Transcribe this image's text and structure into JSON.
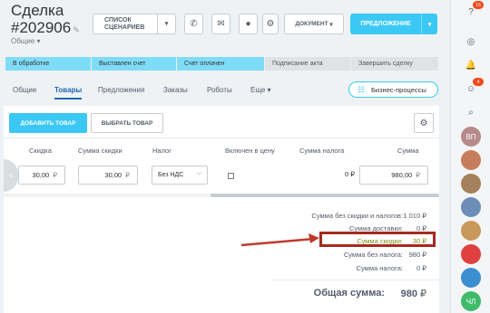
{
  "header": {
    "deal_label": "Сделка",
    "deal_number": "#202906",
    "subtitle": "Общие",
    "scenarios_button": "СПИСОК СЦЕНАРИЕВ",
    "document_button": "ДОКУМЕНТ",
    "offer_button": "ПРЕДЛОЖЕНИЕ"
  },
  "stages": [
    {
      "label": "В обработке",
      "state": "done"
    },
    {
      "label": "Выставлен счет",
      "state": "done"
    },
    {
      "label": "Счет оплачен",
      "state": "done"
    },
    {
      "label": "Подписание акта",
      "state": "todo"
    },
    {
      "label": "Завершить сделку",
      "state": "todo"
    }
  ],
  "tabs": [
    "Общие",
    "Товары",
    "Предложения",
    "Заказы",
    "Роботы",
    "Еще"
  ],
  "active_tab": "Товары",
  "business_processes_button": "Бизнес-процессы",
  "products": {
    "add_button": "ДОБАВИТЬ ТОВАР",
    "select_button": "ВЫБРАТЬ ТОВАР",
    "columns": [
      "Скидка",
      "Сумма скидки",
      "Налог",
      "Включен в цену",
      "Сумма налога",
      "Сумма"
    ],
    "row": {
      "discount": "30,00",
      "discount_sum": "30,00",
      "tax": "Без НДС",
      "tax_included": false,
      "tax_sum": "0",
      "sum": "980,00",
      "currency": "₽"
    }
  },
  "totals": [
    {
      "label": "Сумма без скидки и налогов:",
      "value": "1 010 ₽"
    },
    {
      "label": "Сумма доставки:",
      "value": "0 ₽"
    },
    {
      "label": "Сумма скидки:",
      "value": "30 ₽",
      "highlighted": true
    },
    {
      "label": "Сумма без налога:",
      "value": "980 ₽"
    },
    {
      "label": "Сумма налога:",
      "value": "0 ₽"
    }
  ],
  "grand_total": {
    "label": "Общая сумма:",
    "value": "980",
    "currency": "₽"
  },
  "right_bar": {
    "notifications_count": "16",
    "chat_count": "4",
    "avatars": [
      {
        "initials": "ВП",
        "color": "#b58a8a"
      },
      {
        "initials": "",
        "color": "#c77d5c"
      },
      {
        "initials": "",
        "color": "#a5805c"
      },
      {
        "initials": "",
        "color": "#6c8db6"
      },
      {
        "initials": "",
        "color": "#c8995a"
      },
      {
        "initials": "",
        "color": "#e04040"
      },
      {
        "initials": "",
        "color": "#3b8fd1"
      },
      {
        "initials": "ЧЛ",
        "color": "#3fba6a"
      }
    ]
  },
  "colors": {
    "accent": "#3bc8f5",
    "highlight_border": "#a52a1f",
    "arrow": "#c0392b"
  }
}
